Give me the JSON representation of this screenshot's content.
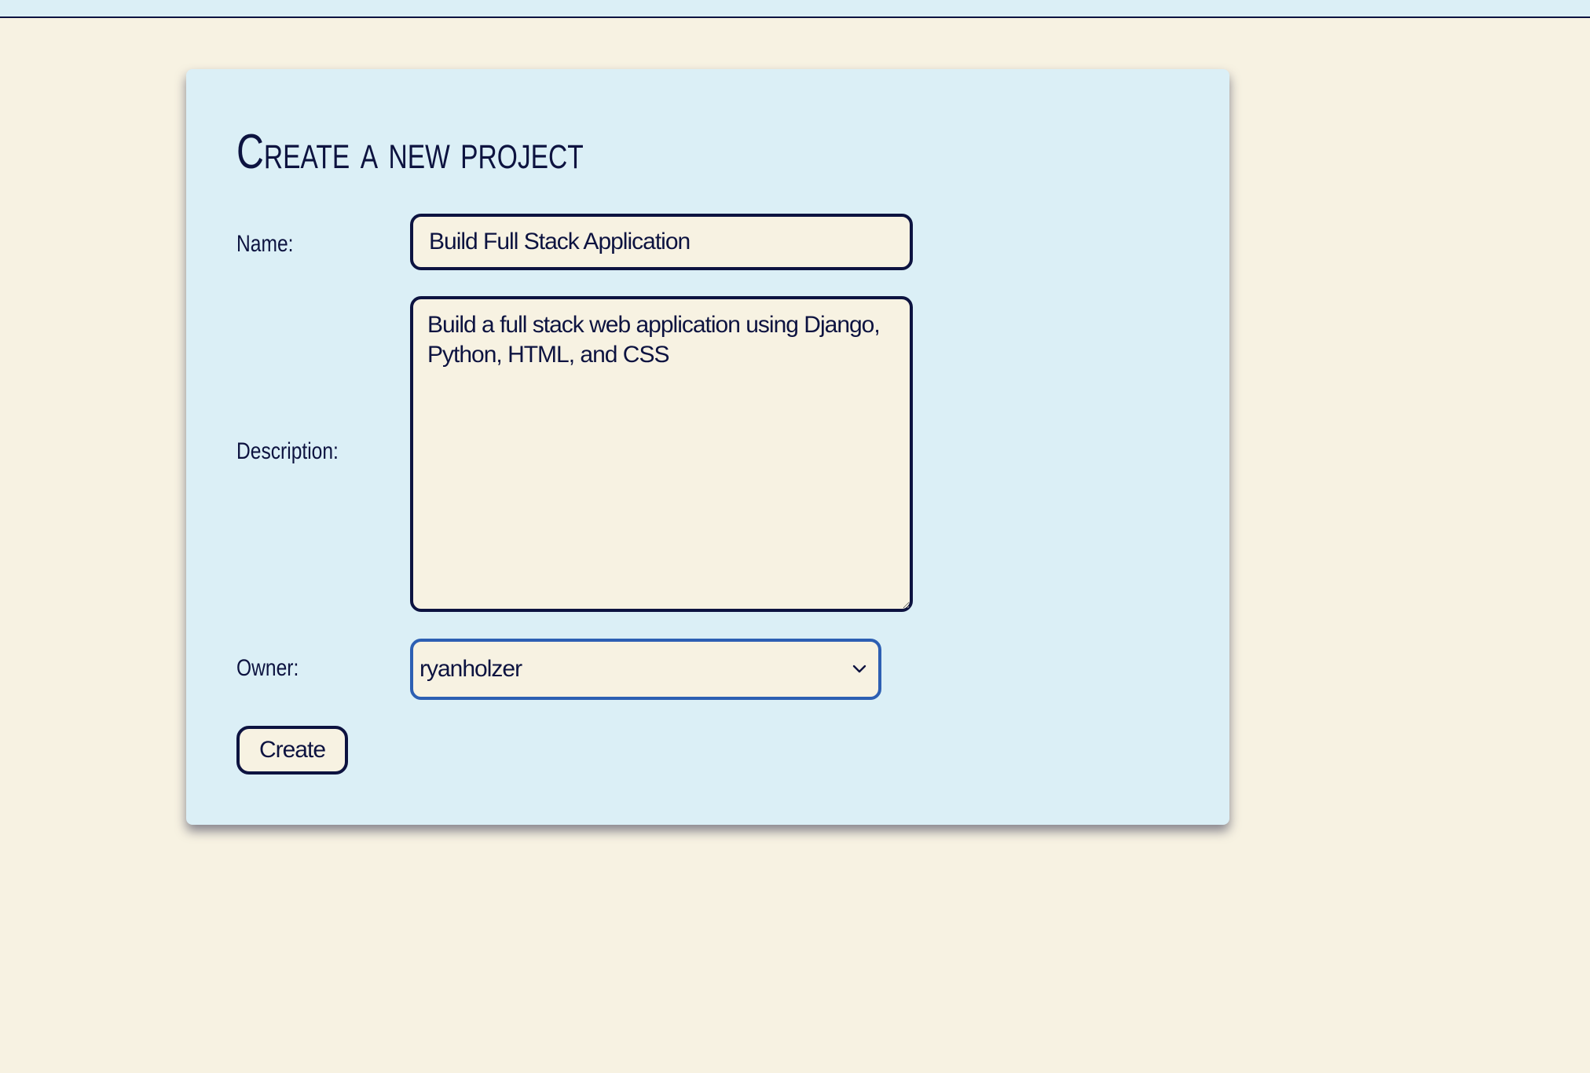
{
  "form": {
    "title": "Create a new project",
    "name_label": "Name:",
    "name_value": "Build Full Stack Application",
    "description_label": "Description:",
    "description_value": "Build a full stack web application using Django, Python, HTML, and CSS",
    "owner_label": "Owner:",
    "owner_selected": "ryanholzer",
    "submit_label": "Create"
  },
  "icons": {
    "select_arrow": "chevron-down-icon"
  },
  "colors": {
    "background": "#F7F2E2",
    "card": "#DBEFF6",
    "text": "#0D1340",
    "focus_border": "#2D5FB3"
  }
}
